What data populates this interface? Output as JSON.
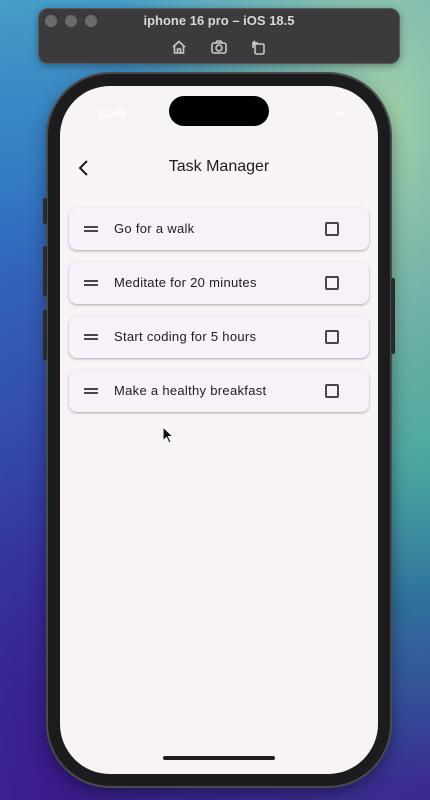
{
  "simulator": {
    "title": "iphone 16 pro – iOS 18.5",
    "tools": [
      "home-icon",
      "screenshot-icon",
      "rotate-icon"
    ]
  },
  "status_bar": {
    "time": "12:46",
    "indicators": "••"
  },
  "header": {
    "title": "Task Manager"
  },
  "tasks": [
    {
      "label": "Go for a walk",
      "done": false
    },
    {
      "label": "Meditate for 20 minutes",
      "done": false
    },
    {
      "label": "Start coding for 5 hours",
      "done": false
    },
    {
      "label": "Make a healthy breakfast",
      "done": false
    }
  ],
  "colors": {
    "screen_bg": "#f8f3f7",
    "card_bg": "#f7f2fa",
    "text": "#1d1b20",
    "checkbox_border": "#49454f"
  }
}
